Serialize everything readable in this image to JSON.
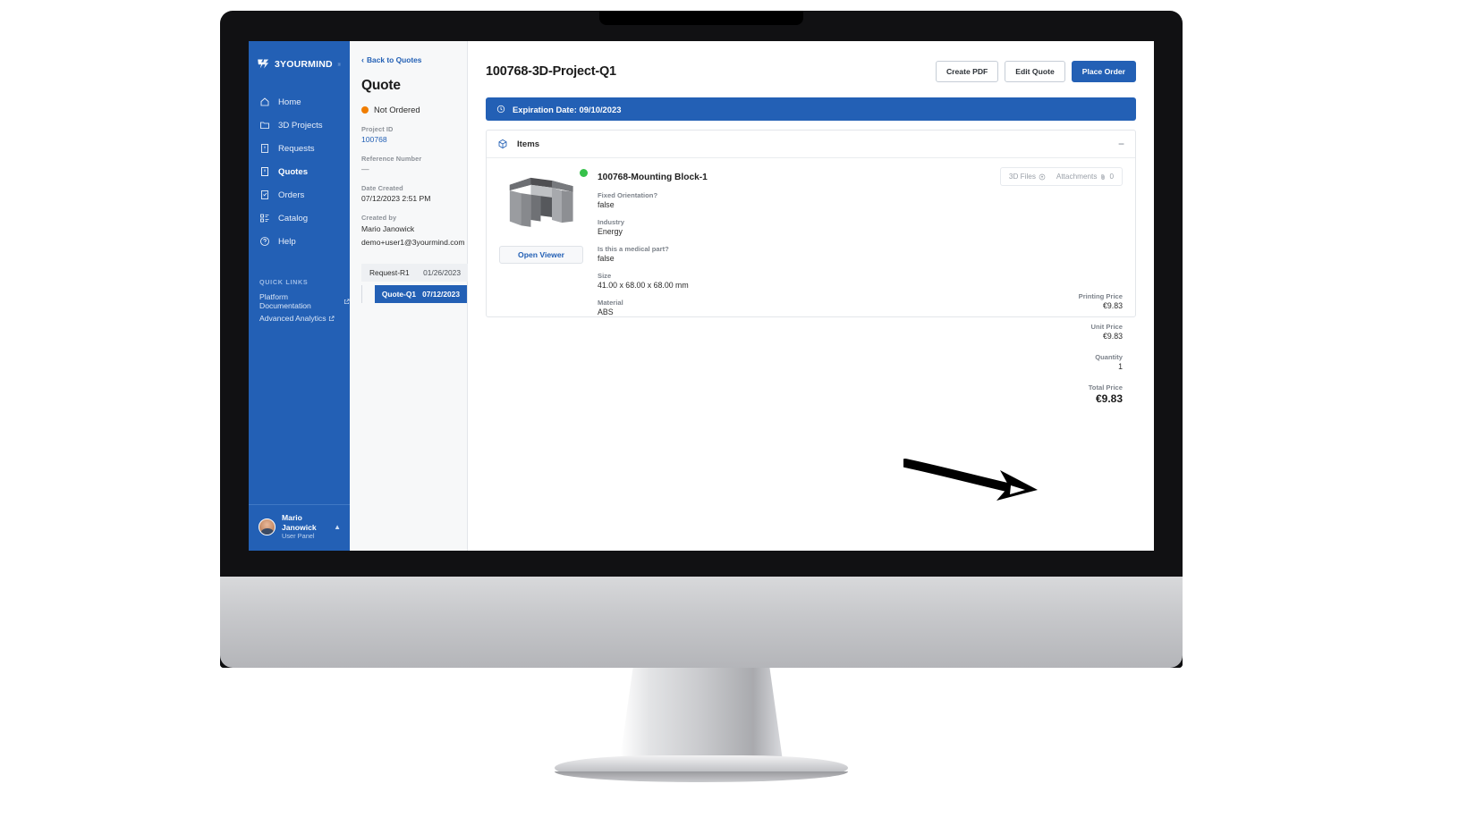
{
  "sidebar": {
    "brand": "3YOURMIND",
    "menu_icon": "hamburger-icon",
    "items": [
      {
        "label": "Home",
        "icon": "home-icon",
        "active": false
      },
      {
        "label": "3D Projects",
        "icon": "folder-icon",
        "active": false
      },
      {
        "label": "Requests",
        "icon": "request-icon",
        "active": false
      },
      {
        "label": "Quotes",
        "icon": "quote-icon",
        "active": true
      },
      {
        "label": "Orders",
        "icon": "order-icon",
        "active": false
      },
      {
        "label": "Catalog",
        "icon": "catalog-icon",
        "active": false
      },
      {
        "label": "Help",
        "icon": "help-icon",
        "active": false
      }
    ],
    "quick_links_title": "QUICK LINKS",
    "quick_links": [
      {
        "label": "Platform Documentation",
        "icon": "external-link-icon"
      },
      {
        "label": "Advanced Analytics",
        "icon": "external-link-icon"
      }
    ],
    "user": {
      "name": "Mario Janowick",
      "role": "User Panel",
      "chevron": "chevron-up-icon"
    }
  },
  "quote_panel": {
    "back_link": "Back to Quotes",
    "title": "Quote",
    "status": "Not Ordered",
    "status_color": "#f07d00",
    "project_id_label": "Project ID",
    "project_id_value": "100768",
    "reference_label": "Reference Number",
    "reference_value": "—",
    "date_created_label": "Date Created",
    "date_created_value": "07/12/2023 2:51 PM",
    "created_by_label": "Created by",
    "created_by_name": "Mario Janowick",
    "created_by_email": "demo+user1@3yourmind.com",
    "tree": [
      {
        "label": "Request-R1",
        "date": "01/26/2023",
        "selected": false
      },
      {
        "label": "Quote-Q1",
        "date": "07/12/2023",
        "selected": true
      }
    ]
  },
  "main": {
    "title": "100768-3D-Project-Q1",
    "buttons": [
      {
        "label": "Create PDF",
        "style": "secondary"
      },
      {
        "label": "Edit Quote",
        "style": "secondary"
      },
      {
        "label": "Place Order",
        "style": "primary"
      }
    ],
    "expiration_banner": "Expiration Date: 09/10/2023",
    "expiration_icon": "clock-icon",
    "card": {
      "icon": "cube-icon",
      "title": "Items",
      "collapse_icon": "minus-icon"
    },
    "item": {
      "name": "100768-Mounting Block-1",
      "status_dot_color": "#36c14a",
      "open_viewer_label": "Open Viewer",
      "files_box": [
        {
          "label": "3D Files",
          "icon": "cloud-upload-icon",
          "count": ""
        },
        {
          "label": "Attachments",
          "icon": "paperclip-icon",
          "count": "0"
        }
      ],
      "attributes": [
        {
          "label": "Fixed Orientation?",
          "value": "false"
        },
        {
          "label": "Industry",
          "value": "Energy"
        },
        {
          "label": "Is this a medical part?",
          "value": "false"
        },
        {
          "label": "Size",
          "value": "41.00 x 68.00 x 68.00 mm"
        },
        {
          "label": "Material",
          "value": "ABS"
        }
      ],
      "prices": [
        {
          "label": "Printing Price",
          "value": "€9.83",
          "total": false
        },
        {
          "label": "Unit Price",
          "value": "€9.83",
          "total": false
        },
        {
          "label": "Quantity",
          "value": "1",
          "total": false
        },
        {
          "label": "Total Price",
          "value": "€9.83",
          "total": true
        }
      ]
    }
  },
  "annotation": {
    "arrow": "hand-drawn-arrow pointing to Total Price"
  },
  "colors": {
    "brand_blue": "#2360b5",
    "status_orange": "#f07d00",
    "status_green": "#36c14a"
  }
}
